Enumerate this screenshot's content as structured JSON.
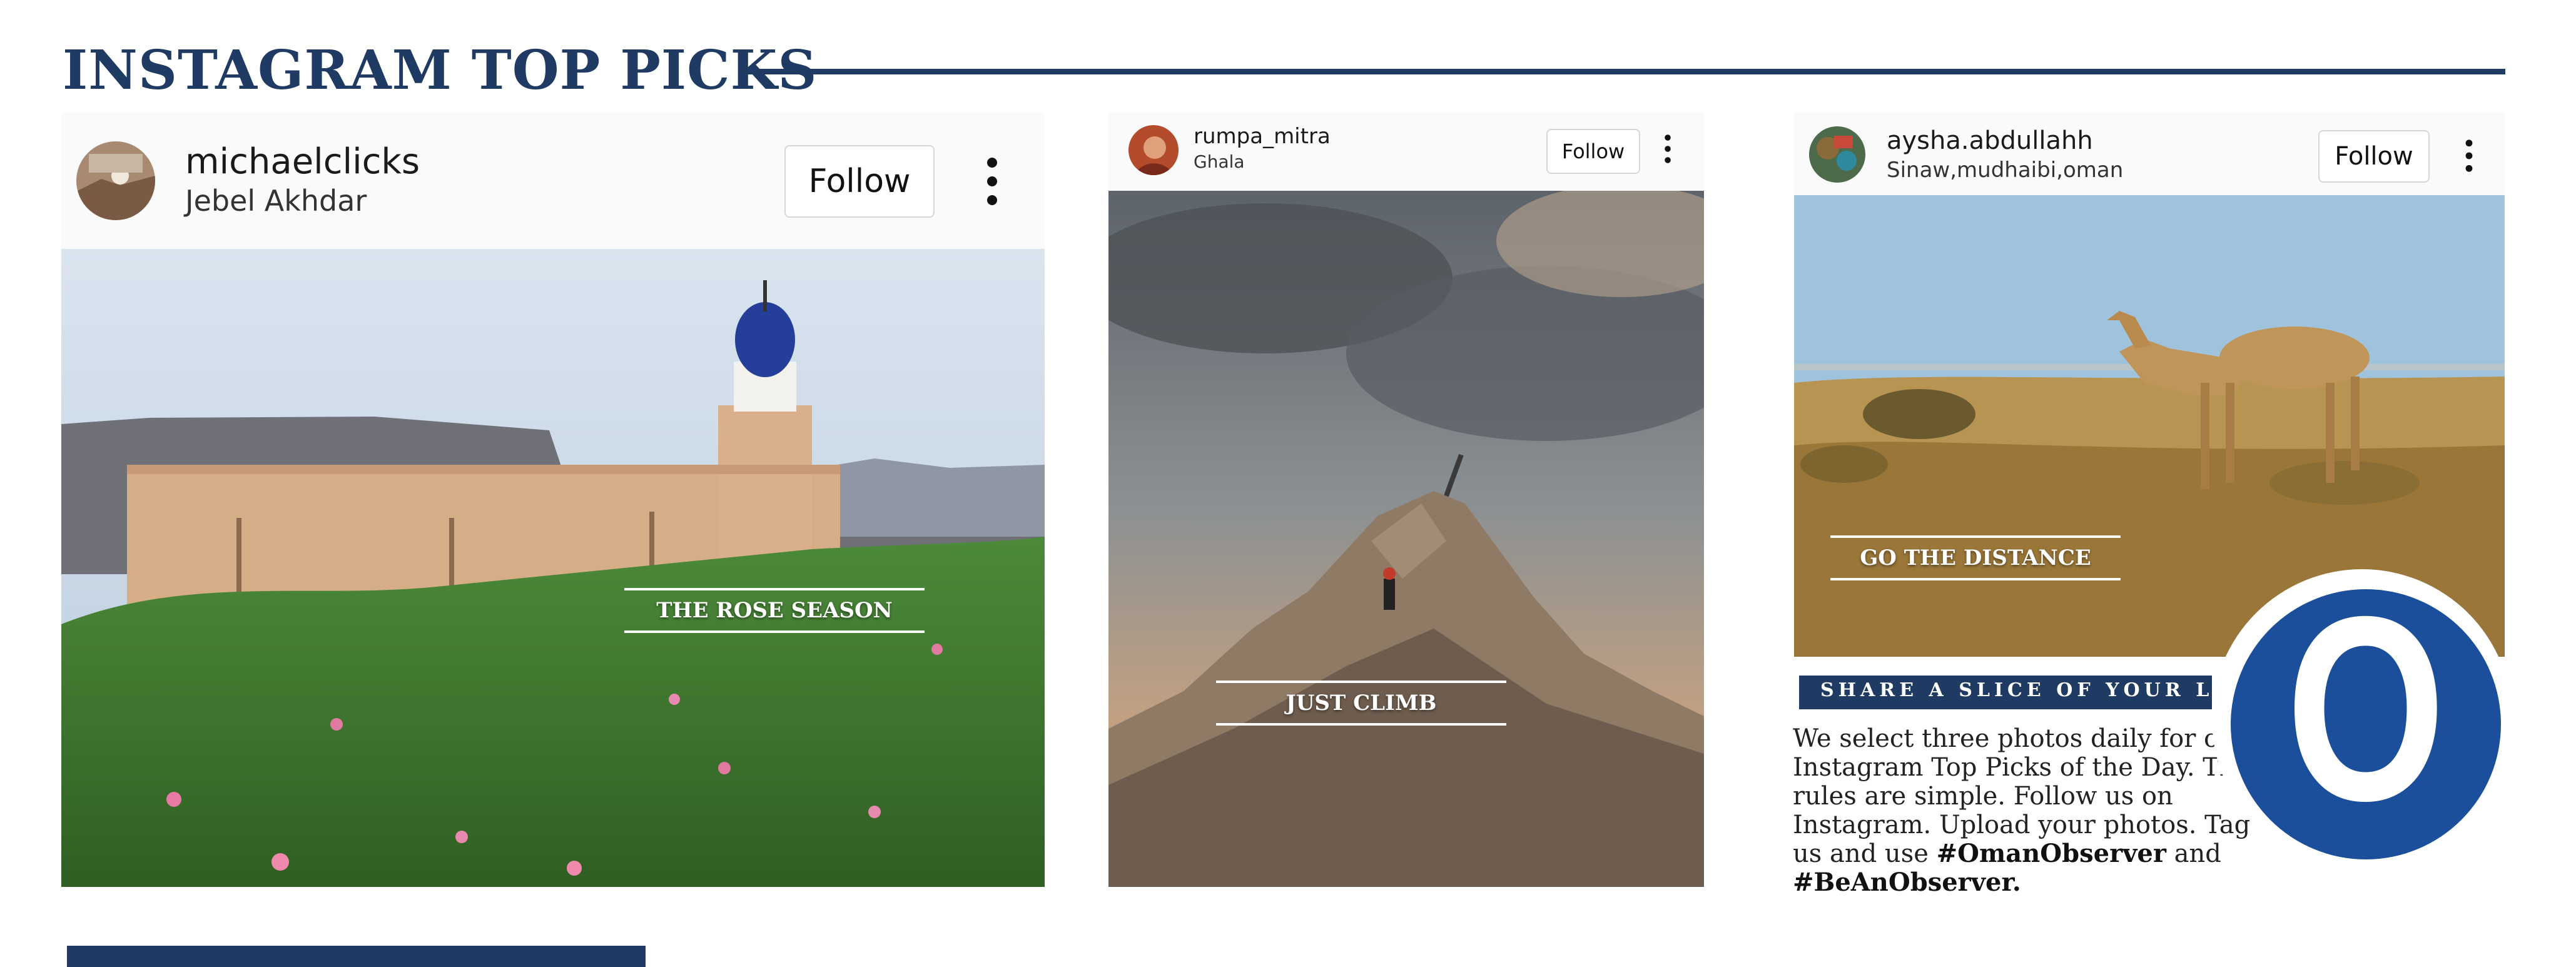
{
  "section": {
    "title": "INSTAGRAM TOP PICKS"
  },
  "posts": [
    {
      "username": "michaelclicks",
      "location": "Jebel Akhdar",
      "follow_label": "Follow",
      "caption": "THE ROSE SEASON"
    },
    {
      "username": "rumpa_mitra",
      "location": "Ghala",
      "follow_label": "Follow",
      "caption": "JUST CLIMB"
    },
    {
      "username": "aysha.abdullahh",
      "location": "Sinaw,mudhaibi,oman",
      "follow_label": "Follow",
      "caption": "GO THE DISTANCE"
    }
  ],
  "share": {
    "banner": "SHARE A SLICE OF YOUR LIFE",
    "body": "We select three photos daily for our Instagram Top Picks of the Day. The rules are simple. Follow us on Instagram. Upload your photos. Tag us and use",
    "hashtag1": "#OmanObserver",
    "connector": "and",
    "hashtag2": "#BeAnObserver."
  },
  "logo": {
    "letter": "O"
  },
  "colors": {
    "brand_navy": "#1f3a63",
    "logo_blue": "#1b4f9c"
  }
}
